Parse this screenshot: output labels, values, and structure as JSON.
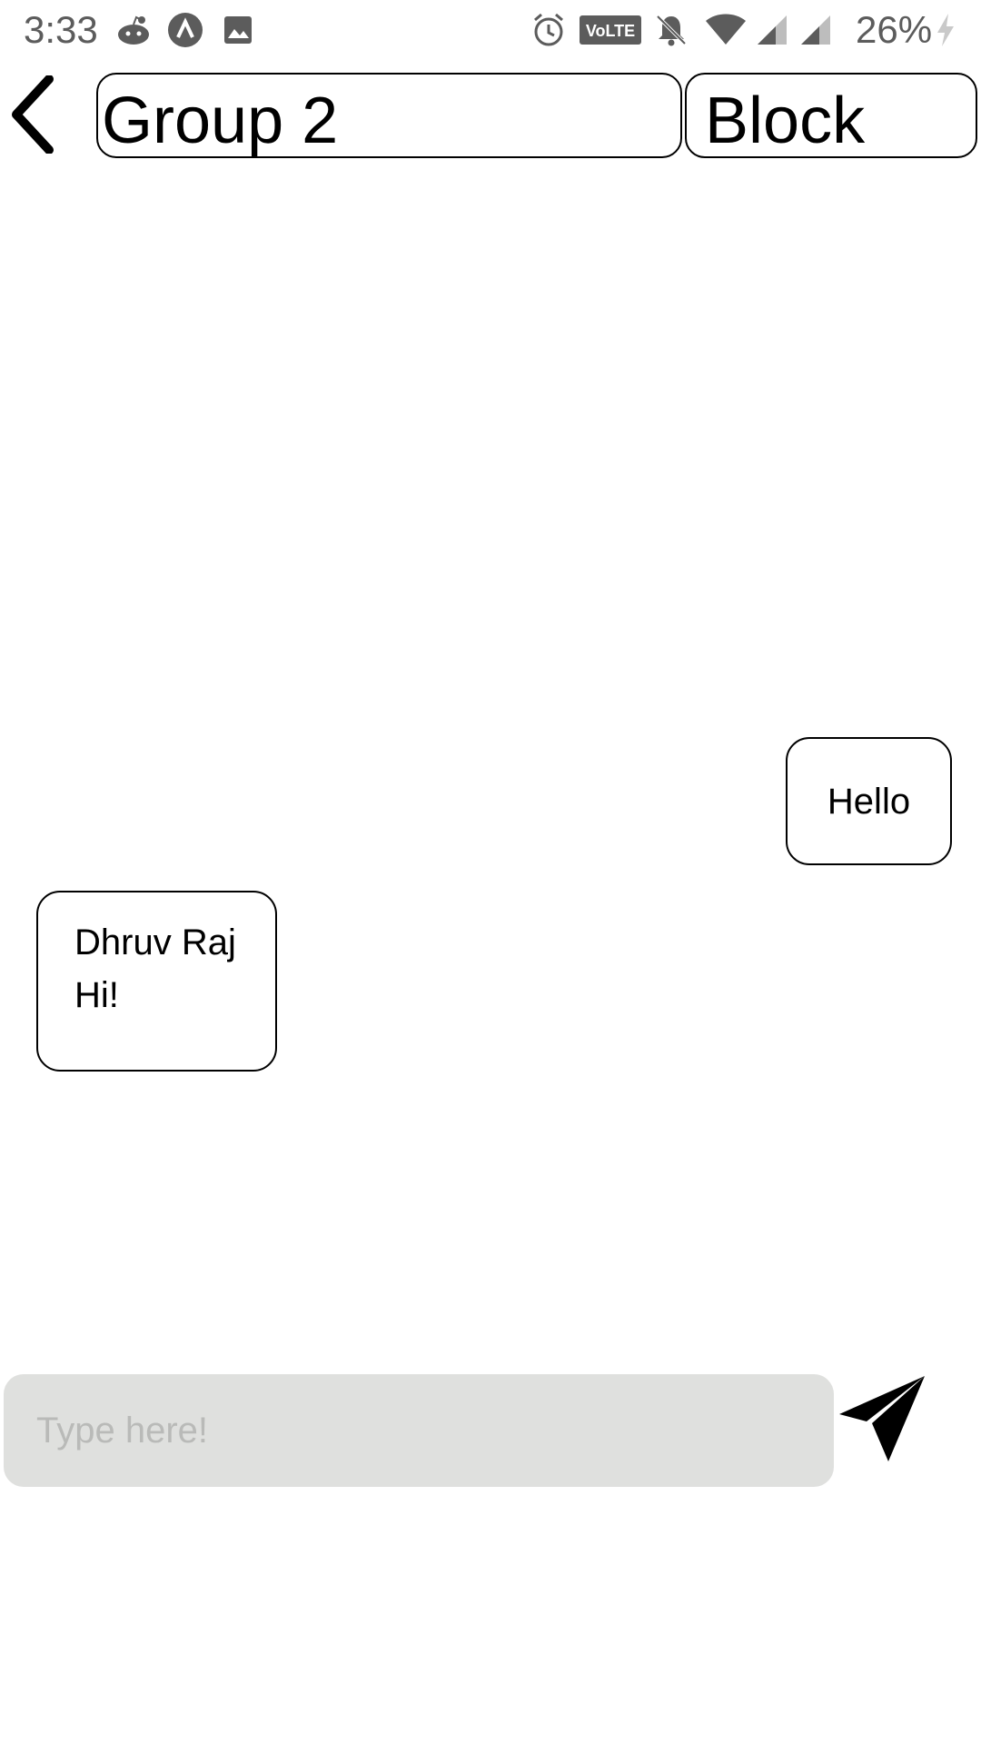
{
  "status_bar": {
    "time": "3:33",
    "battery_percent": "26%",
    "icons": [
      "reddit-icon",
      "app-icon",
      "image-icon",
      "alarm-icon",
      "volte-icon",
      "mute-icon",
      "wifi-icon",
      "signal-icon",
      "signal-icon",
      "charging-icon"
    ]
  },
  "header": {
    "title": "Group 2",
    "block_label": "Block"
  },
  "messages": [
    {
      "direction": "sent",
      "text": "Hello"
    },
    {
      "direction": "received",
      "sender": "Dhruv Raj",
      "text": "Hi!"
    }
  ],
  "composer": {
    "placeholder": "Type here!",
    "value": ""
  },
  "colors": {
    "input_background": "#dfe0de",
    "placeholder": "#b9bab8",
    "status_text": "#5c5c5c"
  }
}
